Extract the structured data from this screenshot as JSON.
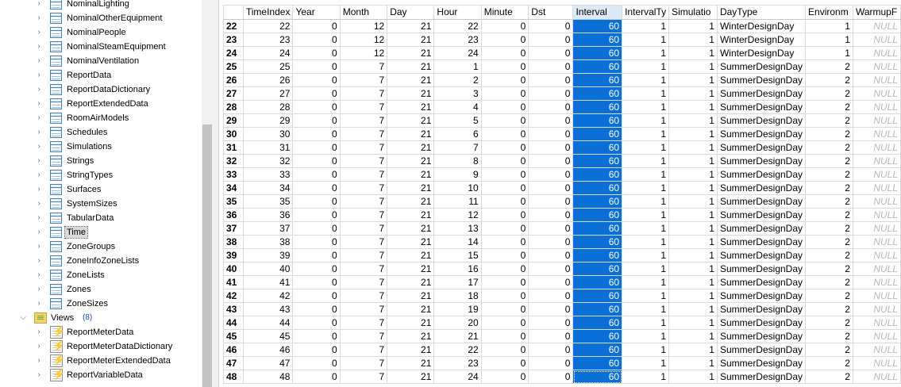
{
  "tree": {
    "items": [
      {
        "label": "NominalLighting",
        "icon": "table-icon"
      },
      {
        "label": "NominalOtherEquipment",
        "icon": "table-icon"
      },
      {
        "label": "NominalPeople",
        "icon": "table-icon"
      },
      {
        "label": "NominalSteamEquipment",
        "icon": "table-icon"
      },
      {
        "label": "NominalVentilation",
        "icon": "table-icon"
      },
      {
        "label": "ReportData",
        "icon": "table-icon"
      },
      {
        "label": "ReportDataDictionary",
        "icon": "table-icon"
      },
      {
        "label": "ReportExtendedData",
        "icon": "table-icon"
      },
      {
        "label": "RoomAirModels",
        "icon": "table-icon"
      },
      {
        "label": "Schedules",
        "icon": "table-icon"
      },
      {
        "label": "Simulations",
        "icon": "table-icon"
      },
      {
        "label": "Strings",
        "icon": "table-icon"
      },
      {
        "label": "StringTypes",
        "icon": "table-icon"
      },
      {
        "label": "Surfaces",
        "icon": "table-icon"
      },
      {
        "label": "SystemSizes",
        "icon": "table-icon"
      },
      {
        "label": "TabularData",
        "icon": "table-icon"
      },
      {
        "label": "Time",
        "icon": "table-icon",
        "selected": true
      },
      {
        "label": "ZoneGroups",
        "icon": "table-icon"
      },
      {
        "label": "ZoneInfoZoneLists",
        "icon": "table-icon"
      },
      {
        "label": "ZoneLists",
        "icon": "table-icon"
      },
      {
        "label": "Zones",
        "icon": "table-icon"
      },
      {
        "label": "ZoneSizes",
        "icon": "table-icon"
      }
    ],
    "views_folder": {
      "label": "Views",
      "count": "(8)",
      "icon": "views-folder-icon"
    },
    "views": [
      {
        "label": "ReportMeterData",
        "icon": "view-icon"
      },
      {
        "label": "ReportMeterDataDictionary",
        "icon": "view-icon"
      },
      {
        "label": "ReportMeterExtendedData",
        "icon": "view-icon"
      },
      {
        "label": "ReportVariableData",
        "icon": "view-icon"
      }
    ]
  },
  "grid": {
    "columns": [
      "TimeIndex",
      "Year",
      "Month",
      "Day",
      "Hour",
      "Minute",
      "Dst",
      "Interval",
      "IntervalTy",
      "Simulatio",
      "DayType",
      "Environm",
      "WarmupF"
    ],
    "selected_column": "Interval",
    "selection_color": "#0a6fd6",
    "null_text": "NULL",
    "rows": [
      {
        "n": "22",
        "cells": [
          "22",
          "0",
          "12",
          "21",
          "22",
          "0",
          "0",
          "60",
          "1",
          "1",
          "WinterDesignDay",
          "1",
          "NULL"
        ]
      },
      {
        "n": "23",
        "cells": [
          "23",
          "0",
          "12",
          "21",
          "23",
          "0",
          "0",
          "60",
          "1",
          "1",
          "WinterDesignDay",
          "1",
          "NULL"
        ]
      },
      {
        "n": "24",
        "cells": [
          "24",
          "0",
          "12",
          "21",
          "24",
          "0",
          "0",
          "60",
          "1",
          "1",
          "WinterDesignDay",
          "1",
          "NULL"
        ]
      },
      {
        "n": "25",
        "cells": [
          "25",
          "0",
          "7",
          "21",
          "1",
          "0",
          "0",
          "60",
          "1",
          "1",
          "SummerDesignDay",
          "2",
          "NULL"
        ]
      },
      {
        "n": "26",
        "cells": [
          "26",
          "0",
          "7",
          "21",
          "2",
          "0",
          "0",
          "60",
          "1",
          "1",
          "SummerDesignDay",
          "2",
          "NULL"
        ]
      },
      {
        "n": "27",
        "cells": [
          "27",
          "0",
          "7",
          "21",
          "3",
          "0",
          "0",
          "60",
          "1",
          "1",
          "SummerDesignDay",
          "2",
          "NULL"
        ]
      },
      {
        "n": "28",
        "cells": [
          "28",
          "0",
          "7",
          "21",
          "4",
          "0",
          "0",
          "60",
          "1",
          "1",
          "SummerDesignDay",
          "2",
          "NULL"
        ]
      },
      {
        "n": "29",
        "cells": [
          "29",
          "0",
          "7",
          "21",
          "5",
          "0",
          "0",
          "60",
          "1",
          "1",
          "SummerDesignDay",
          "2",
          "NULL"
        ]
      },
      {
        "n": "30",
        "cells": [
          "30",
          "0",
          "7",
          "21",
          "6",
          "0",
          "0",
          "60",
          "1",
          "1",
          "SummerDesignDay",
          "2",
          "NULL"
        ]
      },
      {
        "n": "31",
        "cells": [
          "31",
          "0",
          "7",
          "21",
          "7",
          "0",
          "0",
          "60",
          "1",
          "1",
          "SummerDesignDay",
          "2",
          "NULL"
        ]
      },
      {
        "n": "32",
        "cells": [
          "32",
          "0",
          "7",
          "21",
          "8",
          "0",
          "0",
          "60",
          "1",
          "1",
          "SummerDesignDay",
          "2",
          "NULL"
        ]
      },
      {
        "n": "33",
        "cells": [
          "33",
          "0",
          "7",
          "21",
          "9",
          "0",
          "0",
          "60",
          "1",
          "1",
          "SummerDesignDay",
          "2",
          "NULL"
        ]
      },
      {
        "n": "34",
        "cells": [
          "34",
          "0",
          "7",
          "21",
          "10",
          "0",
          "0",
          "60",
          "1",
          "1",
          "SummerDesignDay",
          "2",
          "NULL"
        ]
      },
      {
        "n": "35",
        "cells": [
          "35",
          "0",
          "7",
          "21",
          "11",
          "0",
          "0",
          "60",
          "1",
          "1",
          "SummerDesignDay",
          "2",
          "NULL"
        ]
      },
      {
        "n": "36",
        "cells": [
          "36",
          "0",
          "7",
          "21",
          "12",
          "0",
          "0",
          "60",
          "1",
          "1",
          "SummerDesignDay",
          "2",
          "NULL"
        ]
      },
      {
        "n": "37",
        "cells": [
          "37",
          "0",
          "7",
          "21",
          "13",
          "0",
          "0",
          "60",
          "1",
          "1",
          "SummerDesignDay",
          "2",
          "NULL"
        ]
      },
      {
        "n": "38",
        "cells": [
          "38",
          "0",
          "7",
          "21",
          "14",
          "0",
          "0",
          "60",
          "1",
          "1",
          "SummerDesignDay",
          "2",
          "NULL"
        ]
      },
      {
        "n": "39",
        "cells": [
          "39",
          "0",
          "7",
          "21",
          "15",
          "0",
          "0",
          "60",
          "1",
          "1",
          "SummerDesignDay",
          "2",
          "NULL"
        ]
      },
      {
        "n": "40",
        "cells": [
          "40",
          "0",
          "7",
          "21",
          "16",
          "0",
          "0",
          "60",
          "1",
          "1",
          "SummerDesignDay",
          "2",
          "NULL"
        ]
      },
      {
        "n": "41",
        "cells": [
          "41",
          "0",
          "7",
          "21",
          "17",
          "0",
          "0",
          "60",
          "1",
          "1",
          "SummerDesignDay",
          "2",
          "NULL"
        ]
      },
      {
        "n": "42",
        "cells": [
          "42",
          "0",
          "7",
          "21",
          "18",
          "0",
          "0",
          "60",
          "1",
          "1",
          "SummerDesignDay",
          "2",
          "NULL"
        ]
      },
      {
        "n": "43",
        "cells": [
          "43",
          "0",
          "7",
          "21",
          "19",
          "0",
          "0",
          "60",
          "1",
          "1",
          "SummerDesignDay",
          "2",
          "NULL"
        ]
      },
      {
        "n": "44",
        "cells": [
          "44",
          "0",
          "7",
          "21",
          "20",
          "0",
          "0",
          "60",
          "1",
          "1",
          "SummerDesignDay",
          "2",
          "NULL"
        ]
      },
      {
        "n": "45",
        "cells": [
          "45",
          "0",
          "7",
          "21",
          "21",
          "0",
          "0",
          "60",
          "1",
          "1",
          "SummerDesignDay",
          "2",
          "NULL"
        ]
      },
      {
        "n": "46",
        "cells": [
          "46",
          "0",
          "7",
          "21",
          "22",
          "0",
          "0",
          "60",
          "1",
          "1",
          "SummerDesignDay",
          "2",
          "NULL"
        ]
      },
      {
        "n": "47",
        "cells": [
          "47",
          "0",
          "7",
          "21",
          "23",
          "0",
          "0",
          "60",
          "1",
          "1",
          "SummerDesignDay",
          "2",
          "NULL"
        ]
      },
      {
        "n": "48",
        "cells": [
          "48",
          "0",
          "7",
          "21",
          "24",
          "0",
          "0",
          "60",
          "1",
          "1",
          "SummerDesignDay",
          "2",
          "NULL"
        ]
      }
    ]
  }
}
